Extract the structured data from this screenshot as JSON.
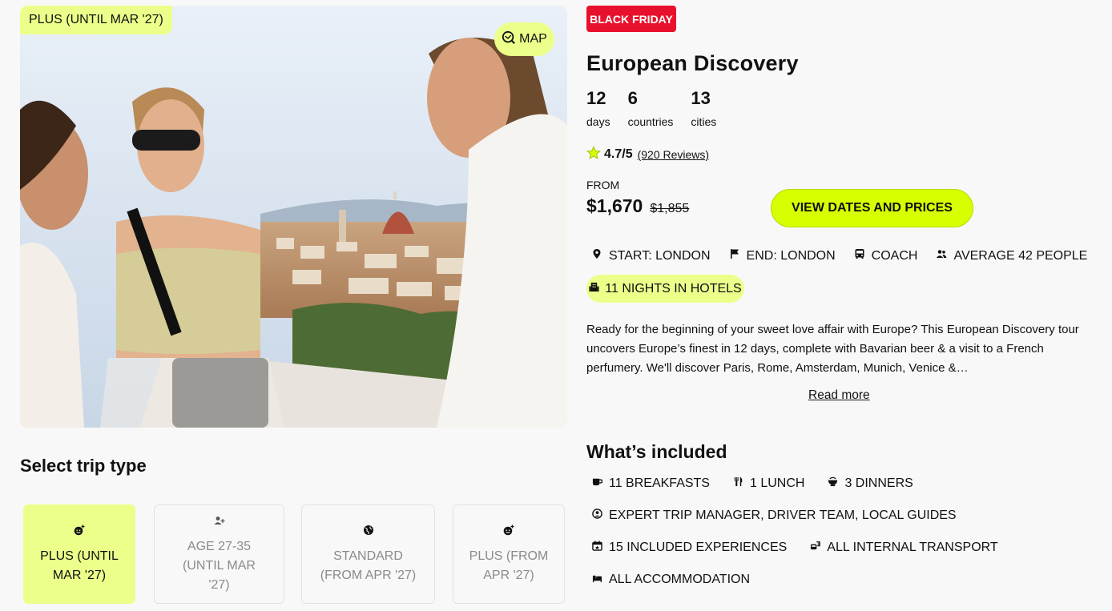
{
  "hero": {
    "badge": "PLUS (UNTIL MAR '27)",
    "map_label": "MAP"
  },
  "trip": {
    "badge": "BLACK FRIDAY",
    "title": "European Discovery",
    "stats": [
      {
        "value": "12",
        "label": "days"
      },
      {
        "value": "6",
        "label": "countries"
      },
      {
        "value": "13",
        "label": "cities"
      }
    ],
    "rating": {
      "score": "4.7/5",
      "reviews": "(920 Reviews)"
    },
    "price": {
      "from_label": "FROM",
      "current": "$1,670",
      "original": "$1,855"
    },
    "cta_label": "VIEW DATES AND PRICES",
    "facts": [
      {
        "icon": "location-pin-icon",
        "label": "START: LONDON"
      },
      {
        "icon": "flag-icon",
        "label": "END: LONDON"
      },
      {
        "icon": "coach-icon",
        "label": "COACH"
      },
      {
        "icon": "people-icon",
        "label": "AVERAGE 42 PEOPLE"
      }
    ],
    "hotels": "11 NIGHTS IN HOTELS",
    "description": "Ready for the beginning of your sweet love affair with Europe? This European Discovery tour uncovers Europe’s finest in 12 days, complete with Bavarian beer & a visit to a French perfumery. We'll discover Paris, Rome, Amsterdam, Munich, Venice &…",
    "read_more": "Read more"
  },
  "included": {
    "title": "What’s included",
    "rows": [
      [
        {
          "icon": "breakfast-icon",
          "label": "11 BREAKFASTS"
        },
        {
          "icon": "cutlery-icon",
          "label": "1 LUNCH"
        },
        {
          "icon": "dinner-icon",
          "label": "3 DINNERS"
        }
      ],
      [
        {
          "icon": "guide-icon",
          "label": "EXPERT TRIP MANAGER, DRIVER TEAM, LOCAL GUIDES"
        }
      ],
      [
        {
          "icon": "calendar-star-icon",
          "label": "15 INCLUDED EXPERIENCES"
        },
        {
          "icon": "transport-icon",
          "label": "ALL INTERNAL TRANSPORT"
        }
      ],
      [
        {
          "icon": "bed-icon",
          "label": "ALL ACCOMMODATION"
        }
      ]
    ]
  },
  "trip_type": {
    "title": "Select trip type",
    "options": [
      {
        "label": "PLUS (UNTIL MAR '27)",
        "icon": "plus-smile-icon",
        "selected": true
      },
      {
        "label": "AGE 27-35 (UNTIL MAR '27)",
        "icon": "add-person-icon",
        "selected": false
      },
      {
        "label": "STANDARD (FROM APR '27)",
        "icon": "globe-icon",
        "selected": false
      },
      {
        "label": "PLUS (FROM APR '27)",
        "icon": "plus-smile-icon",
        "selected": false
      }
    ]
  },
  "colors": {
    "accent_lime": "#d8ff00",
    "pill_lime": "#ebff8a",
    "black_friday_red": "#e8112d"
  }
}
